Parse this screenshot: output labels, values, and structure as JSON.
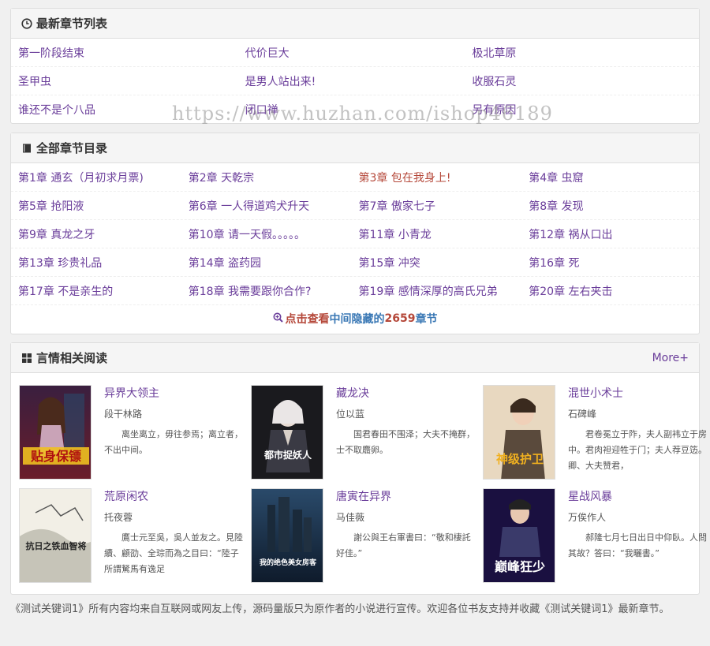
{
  "latest": {
    "title": "最新章节列表",
    "rows": [
      [
        "第一阶段结束",
        "代价巨大",
        "极北草原"
      ],
      [
        "圣甲虫",
        "是男人站出来!",
        "收服石灵"
      ],
      [
        "谁还不是个八品",
        "闭口禅",
        "另有原因"
      ]
    ]
  },
  "all": {
    "title": "全部章节目录",
    "rows": [
      [
        "第1章 通玄（月初求月票)",
        "第2章 天乾宗",
        "第3章 包在我身上!",
        "第4章 虫窟"
      ],
      [
        "第5章 抢阳液",
        "第6章 一人得道鸡犬升天",
        "第7章 傲家七子",
        "第8章 发现"
      ],
      [
        "第9章 真龙之牙",
        "第10章 请一天假。。。。。",
        "第11章 小青龙",
        "第12章 祸从口出"
      ],
      [
        "第13章 珍贵礼品",
        "第14章 盗药园",
        "第15章 冲突",
        "第16章 死"
      ],
      [
        "第17章 不是亲生的",
        "第18章 我需要跟你合作?",
        "第19章 感情深厚的高氏兄弟",
        "第20章 左右夹击"
      ]
    ],
    "more_a": "点击查看",
    "more_b": "中间隐藏的",
    "more_n": "2659",
    "more_c": "章节"
  },
  "related": {
    "title": "言情相关阅读",
    "more": "More+",
    "books": [
      {
        "title": "异界大领主",
        "author": "段干林路",
        "desc": "离坐离立，毋往参焉；离立者，不出中间。",
        "cover_text": "贴身保镖"
      },
      {
        "title": "藏龙决",
        "author": "位以蓝",
        "desc": "国君春田不围泽；大夫不掩群，士不取麛卵。",
        "cover_text": "都市捉妖人"
      },
      {
        "title": "混世小术士",
        "author": "石碑峰",
        "desc": "君卷冕立于阼，夫人副袆立于房中。君肉袒迎牲于门；夫人荐豆笾。卿、大夫赞君，",
        "cover_text": "神级护卫"
      },
      {
        "title": "荒原闲农",
        "author": "托夜蓉",
        "desc": "鷹士元至吳，吳人並友之。見陸續、顧劭、全琮而為之目曰：“陸子所謂駑馬有逸足",
        "cover_text": "抗日之铁血智将"
      },
      {
        "title": "唐寅在异界",
        "author": "马佳薇",
        "desc": "謝公與王右軍書曰：“敬和棲託好佳。”",
        "cover_text": "我的绝色美女房客"
      },
      {
        "title": "星战风暴",
        "author": "万俟作人",
        "desc": "郝隆七月七日出日中仰臥。人問其故？答曰：“我曬書。”",
        "cover_text": "巅峰狂少"
      }
    ]
  },
  "footer": "《测试关键词1》所有内容均来自互联网或网友上传，源码量版只为原作者的小说进行宣传。欢迎各位书友支持并收藏《测试关键词1》最新章节。",
  "watermark": "https://www.huzhan.com/ishop46189"
}
